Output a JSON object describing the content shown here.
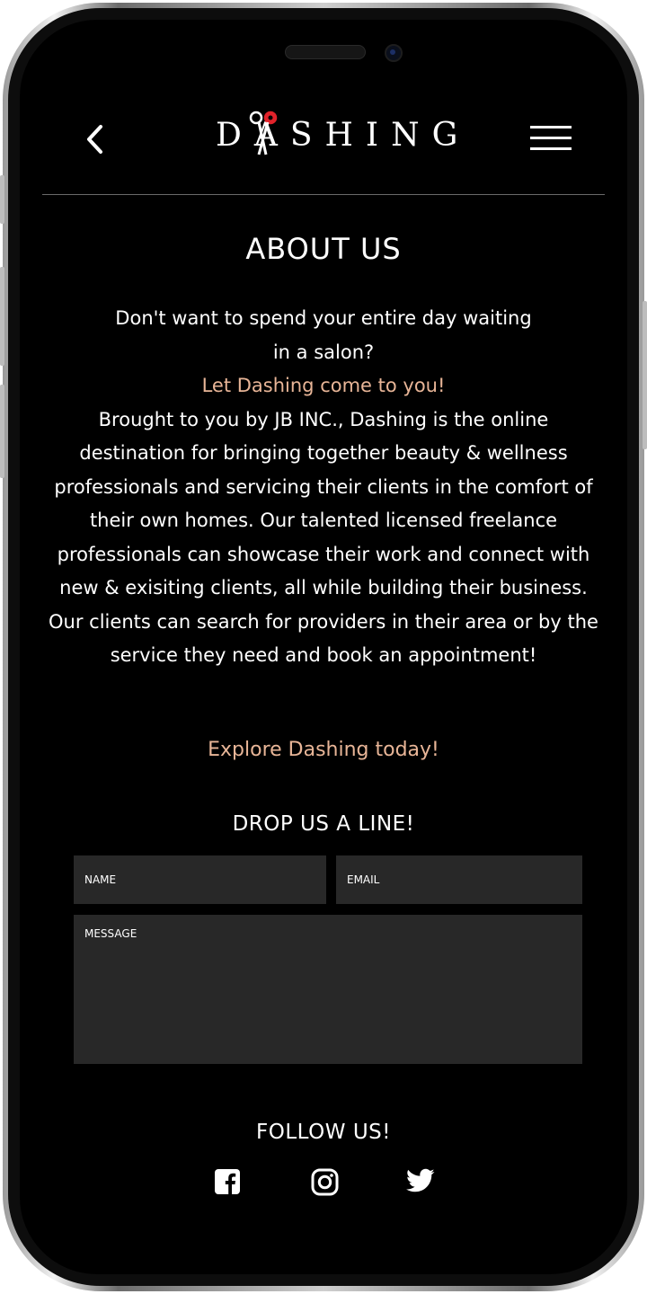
{
  "header": {
    "logo_text": "DASHING",
    "back_icon": "chevron-left-icon",
    "menu_icon": "hamburger-menu-icon"
  },
  "about": {
    "title": "ABOUT US",
    "intro_line1": "Don't want to spend your entire day waiting",
    "intro_line2": "in a salon?",
    "tagline": "Let Dashing come to you!",
    "body": "Brought to you by JB INC., Dashing is the online destination for bringing together beauty & wellness professionals and servicing their clients in the comfort of their own homes. Our talented licensed freelance professionals can showcase their work and connect with new & exisiting clients, all while building their business. Our clients can search for providers in their area or by the service they need and book an appointment!",
    "explore": "Explore Dashing today!"
  },
  "contact": {
    "title": "DROP US A LINE!",
    "name_placeholder": "NAME",
    "email_placeholder": "EMAIL",
    "message_placeholder": "MESSAGE"
  },
  "follow": {
    "title": "FOLLOW US!",
    "icons": [
      "facebook-icon",
      "instagram-icon",
      "twitter-icon"
    ]
  },
  "colors": {
    "accent": "#e8b597",
    "background": "#000000",
    "field": "#282828"
  }
}
